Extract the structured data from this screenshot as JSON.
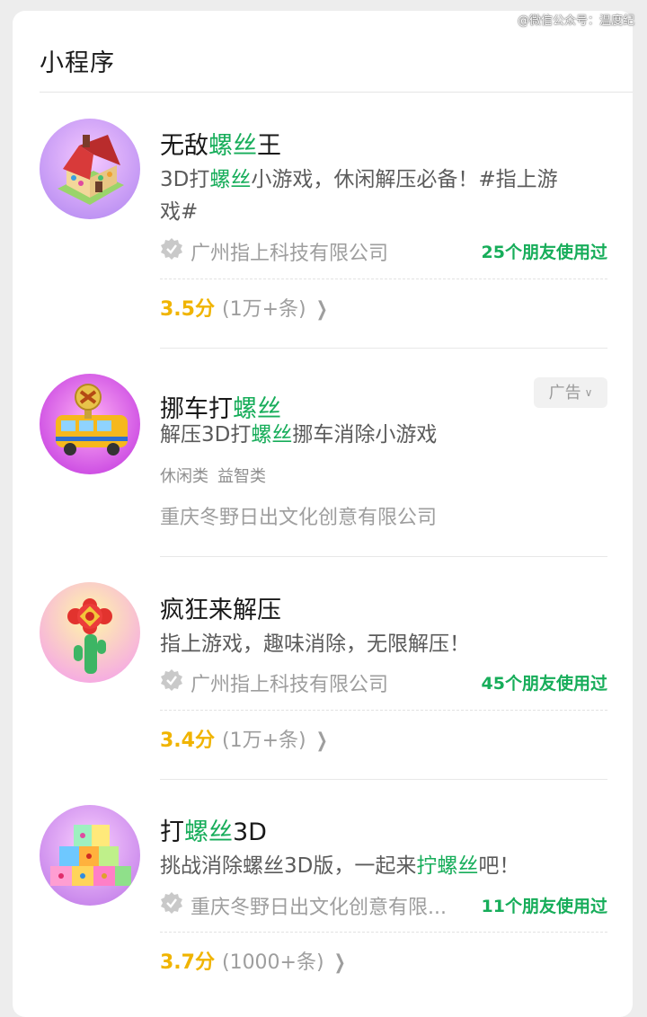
{
  "watermark": "@微信公众号：温度纪",
  "section": {
    "title": "小程序"
  },
  "items": [
    {
      "name_pre": "无敌",
      "name_hl": "螺丝",
      "name_post": "王",
      "desc_line1_pre": "3D打",
      "desc_line1_hl": "螺丝",
      "desc_line1_post": "小游戏，休闲解压必备！#指上游",
      "desc_line2": "戏#",
      "company": "广州指上科技有限公司",
      "friends": "25个朋友使用过",
      "score": "3.5分",
      "reviews": "(1万+条)",
      "icon": "house-game-icon"
    },
    {
      "name_pre": "挪车打",
      "name_hl": "螺丝",
      "ad_label": "广告",
      "desc_pre": "解压3D打",
      "desc_hl": "螺丝",
      "desc_post": "挪车消除小游戏",
      "tags": [
        "休闲类",
        "益智类"
      ],
      "company": "重庆冬野日出文化创意有限公司",
      "icon": "screw-bus-icon"
    },
    {
      "name": "疯狂来解压",
      "desc": "指上游戏，趣味消除，无限解压！",
      "company": "广州指上科技有限公司",
      "friends": "45个朋友使用过",
      "score": "3.4分",
      "reviews": "(1万+条)",
      "icon": "cactus-charm-icon"
    },
    {
      "name_pre": "打",
      "name_hl": "螺丝",
      "name_post": "3D",
      "desc_pre": "挑战消除螺丝3D版，一起来",
      "desc_hl": "拧螺丝",
      "desc_post": "吧！",
      "company": "重庆冬野日出文化创意有限...",
      "friends": "11个朋友使用过",
      "score": "3.7分",
      "reviews": "(1000+条)",
      "icon": "block-tower-icon"
    }
  ],
  "colors": {
    "highlight": "#17ad5a",
    "score": "#f0b400",
    "background": "#ededed"
  }
}
